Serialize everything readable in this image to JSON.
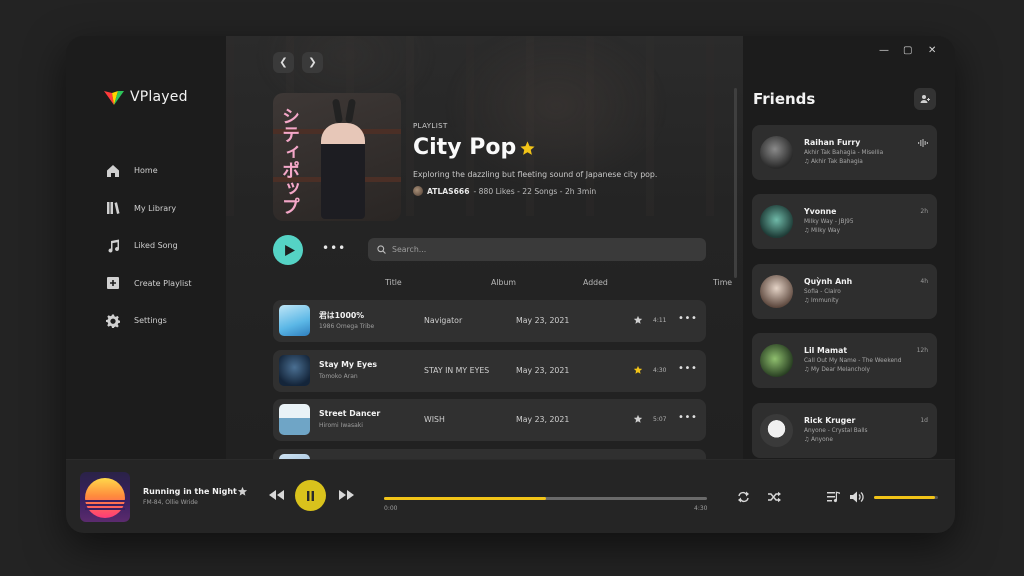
{
  "app": {
    "brand_name": "VPlayed",
    "accent": "#f2c418",
    "teal": "#55d3c5"
  },
  "sidebar": {
    "items": [
      {
        "label": "Home",
        "icon": "home-icon"
      },
      {
        "label": "My Library",
        "icon": "library-icon"
      },
      {
        "label": "Liked Song",
        "icon": "music-note-icon"
      },
      {
        "label": "Create Playlist",
        "icon": "plus-square-icon"
      },
      {
        "label": "Settings",
        "icon": "gear-icon"
      }
    ]
  },
  "playlist": {
    "tag": "PLAYLIST",
    "title": "City Pop",
    "description": "Exploring the dazzling but fleeting sound of Japanese city pop.",
    "owner": "ATLAS666",
    "stats": " - 880 Likes - 22 Songs - 2h 3min",
    "cover_text": "シティポップ"
  },
  "search": {
    "placeholder": "Search..."
  },
  "table": {
    "headers": {
      "title": "Title",
      "album": "Album",
      "added": "Added",
      "time": "Time"
    },
    "rows": [
      {
        "title": "君は1000%",
        "artist": "1986 Omega Tribe",
        "album": "Navigator",
        "added": "May 23, 2021",
        "time": "4:11",
        "liked": false
      },
      {
        "title": "Stay My Eyes",
        "artist": "Tomoko Aran",
        "album": "STAY IN MY EYES",
        "added": "May 23, 2021",
        "time": "4:30",
        "liked": true
      },
      {
        "title": "Street Dancer",
        "artist": "Hiromi Iwasaki",
        "album": "WISH",
        "added": "May 23, 2021",
        "time": "5:07",
        "liked": false
      }
    ]
  },
  "friends": {
    "title": "Friends",
    "items": [
      {
        "name": "Raihan Furry",
        "now": "Akhir Tak Bahagia - Misellia",
        "song": "Akhir Tak Bahagia",
        "time": ""
      },
      {
        "name": "Yvonne",
        "now": "Milky Way - JBJ95",
        "song": "Milky Way",
        "time": "2h"
      },
      {
        "name": "Quỳnh Anh",
        "now": "Sofia - Clairo",
        "song": "Immunity",
        "time": "4h"
      },
      {
        "name": "Lil Mamat",
        "now": "Call Out My Name - The Weekend",
        "song": "My Dear Melancholy",
        "time": "12h"
      },
      {
        "name": "Rick Kruger",
        "now": "Anyone - Crystal Balls",
        "song": "Anyone",
        "time": "1d"
      }
    ]
  },
  "player": {
    "title": "Running in the Night",
    "artist": "FM-84, Ollie Wride",
    "elapsed": "0:00",
    "duration": "4:30",
    "progress_fraction": 0.5,
    "volume_fraction": 0.95
  }
}
